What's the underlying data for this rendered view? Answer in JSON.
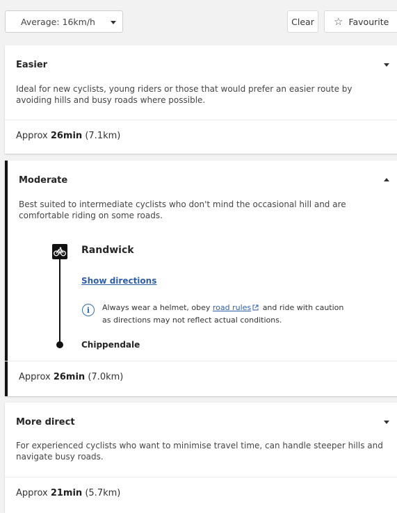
{
  "toolbar": {
    "speed_select": "Average: 16km/h",
    "clear_label": "Clear",
    "favourite_label": "Favourite",
    "favourite_icon": "star-outline-icon"
  },
  "routes": [
    {
      "title": "Easier",
      "description": "Ideal for new cyclists, young riders or those that would prefer an easier route by avoiding hills and busy roads where possible.",
      "approx_prefix": "Approx",
      "duration": "26min",
      "distance": "(7.1km)",
      "expanded": false
    },
    {
      "title": "Moderate",
      "description": "Best suited to intermediate cyclists who don't mind the occasional hill and are comfortable riding on some roads.",
      "approx_prefix": "Approx",
      "duration": "26min",
      "distance": "(7.0km)",
      "expanded": true,
      "origin": "Randwick",
      "show_directions": "Show directions",
      "info_before": "Always wear a helmet, obey",
      "info_link": "road rules",
      "info_after": "and ride with caution as directions may not reflect actual conditions.",
      "destination": "Chippendale"
    },
    {
      "title": "More direct",
      "description": "For experienced cyclists who want to minimise travel time, can handle steeper hills and navigate busy roads.",
      "approx_prefix": "Approx",
      "duration": "21min",
      "distance": "(5.7km)",
      "expanded": false
    }
  ],
  "colors": {
    "background": "#f2f2f2",
    "accent": "#111111",
    "link": "#2f5fa8",
    "info": "#2f6cb5"
  }
}
